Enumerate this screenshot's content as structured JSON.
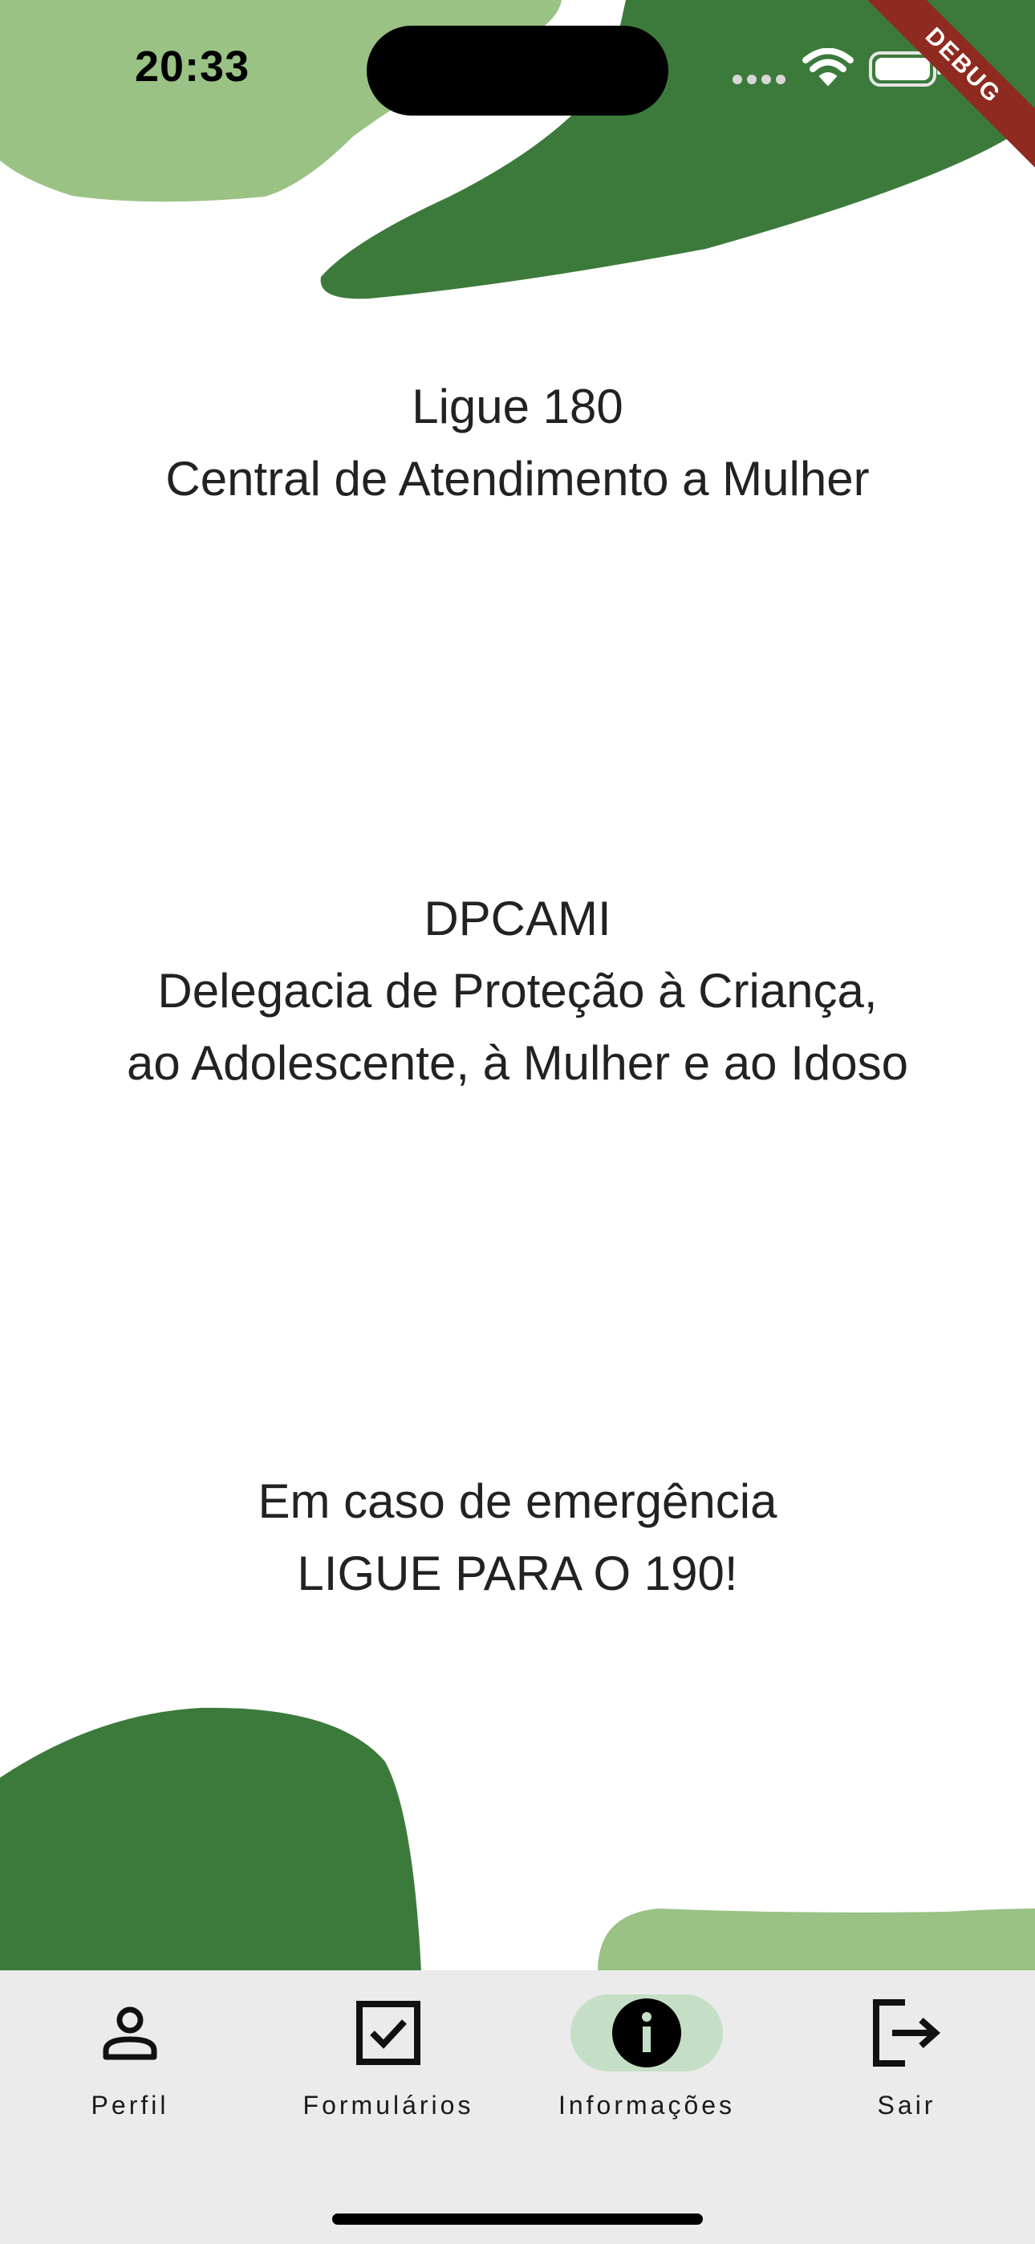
{
  "status_bar": {
    "time": "20:33"
  },
  "debug_banner": "DEBUG",
  "theme": {
    "dark_green": "#3c7a3c",
    "light_green": "#99c284",
    "nav_background": "#ebebeb",
    "active_pill": "#c5dfc6",
    "text": "#222222"
  },
  "content": {
    "block1": {
      "line1": "Ligue 180",
      "line2": "Central de Atendimento a Mulher"
    },
    "block2": {
      "line1": "DPCAMI",
      "line2": "Delegacia de Proteção à Criança,",
      "line3": "ao Adolescente, à Mulher e ao Idoso"
    },
    "block3": {
      "line1": "Em caso de emergência",
      "line2": "LIGUE PARA O 190!"
    }
  },
  "bottom_nav": {
    "active": "Informações",
    "items": [
      {
        "label": "Perfil",
        "icon": "person-icon"
      },
      {
        "label": "Formulários",
        "icon": "checkbox-icon"
      },
      {
        "label": "Informações",
        "icon": "info-icon"
      },
      {
        "label": "Sair",
        "icon": "logout-icon"
      }
    ]
  }
}
